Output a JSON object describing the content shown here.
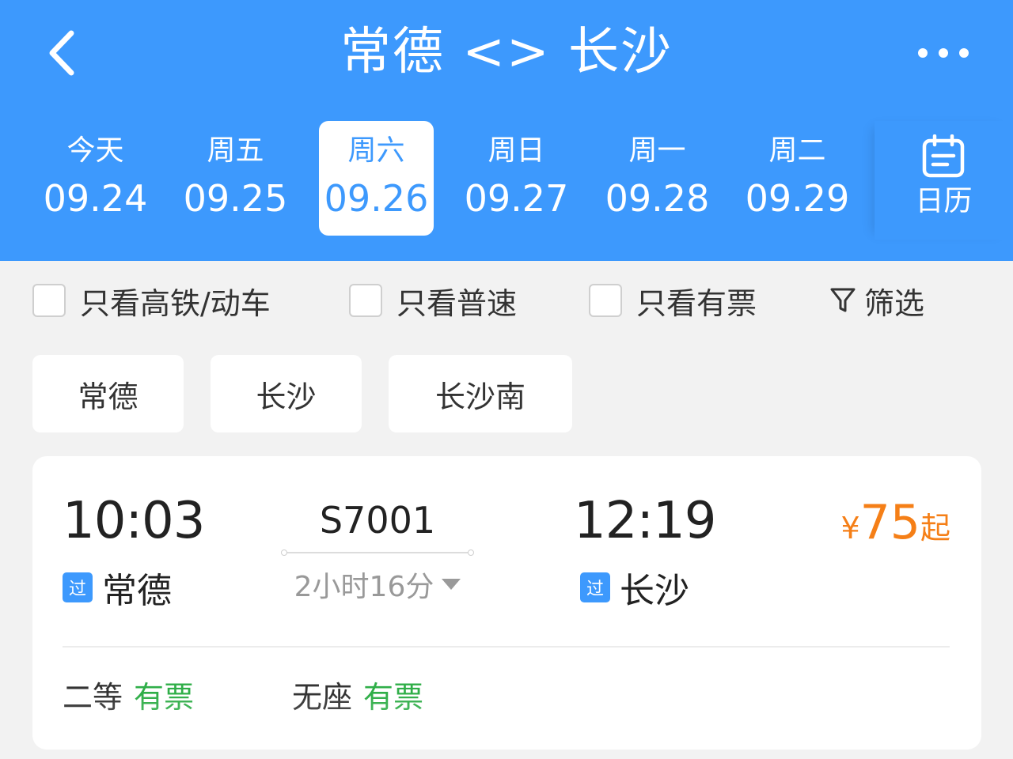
{
  "header": {
    "title": "常德 <> 长沙",
    "background_color": "#3d99fd"
  },
  "date_tabs": [
    {
      "dow": "今天",
      "date": "09.24",
      "selected": false
    },
    {
      "dow": "周五",
      "date": "09.25",
      "selected": false
    },
    {
      "dow": "周六",
      "date": "09.26",
      "selected": true
    },
    {
      "dow": "周日",
      "date": "09.27",
      "selected": false
    },
    {
      "dow": "周一",
      "date": "09.28",
      "selected": false
    },
    {
      "dow": "周二",
      "date": "09.29",
      "selected": false
    }
  ],
  "calendar": {
    "label": "日历",
    "icon": "calendar-icon"
  },
  "filters": {
    "items": [
      {
        "label": "只看高铁/动车",
        "checked": false
      },
      {
        "label": "只看普速",
        "checked": false
      },
      {
        "label": "只看有票",
        "checked": false
      }
    ],
    "filter_label": "筛选",
    "filter_icon": "funnel-icon"
  },
  "stations": [
    "常德",
    "长沙",
    "长沙南"
  ],
  "trains": [
    {
      "departure_time": "10:03",
      "departure_station": "常德",
      "departure_badge": "过",
      "train_number": "S7001",
      "duration": "2小时16分",
      "arrival_time": "12:19",
      "arrival_station": "长沙",
      "arrival_badge": "过",
      "price": {
        "currency": "¥",
        "amount": "75",
        "suffix": "起"
      },
      "seats": [
        {
          "type": "二等",
          "status": "有票"
        },
        {
          "type": "无座",
          "status": "有票"
        }
      ]
    }
  ],
  "colors": {
    "accent": "#3d99fd",
    "price": "#f57f17",
    "available": "#2fae48"
  }
}
